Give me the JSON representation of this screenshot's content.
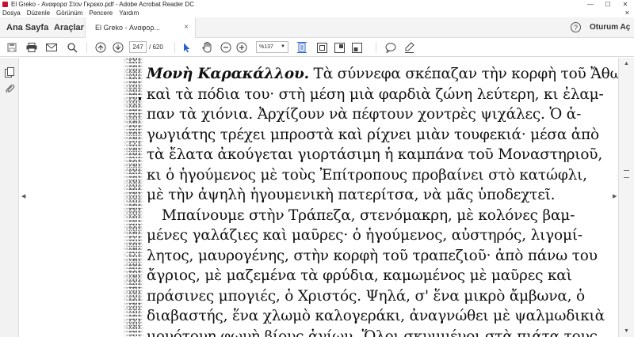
{
  "window": {
    "title": "El Greko - Αναφορα Στον Γκρεκο.pdf - Adobe Acrobat Reader DC",
    "minimize": "—",
    "maximize": "☐",
    "close": "✕"
  },
  "menu": {
    "items": [
      "Dosya",
      "Düzenle",
      "Görünüm",
      "Pencere",
      "Yardım"
    ],
    "close_doc": "×"
  },
  "tabs": {
    "home": "Ana Sayfa",
    "tools": "Araçlar",
    "document": "El Greko - Αναφορ...",
    "document_close": "×",
    "help": "?",
    "signin": "Oturum Aç"
  },
  "toolbar": {
    "page_current": "247",
    "page_count": "/ 620",
    "zoom": "%137"
  },
  "document": {
    "lines": [
      {
        "bold": "Μονὴ Καρακάλλου.",
        "text": " Τὰ σύννεφα σκέπαζαν τὴν κορφὴ τοῦ Ἄθω"
      },
      {
        "bold": "",
        "text": "καὶ τὰ πόδια του· στὴ μέση μιὰ φαρδιὰ ζώνη λεύτερη, κι ἐλαμ-"
      },
      {
        "bold": "",
        "text": "παν τὰ χιόνια. Ἀρχίζουν νὰ πέφτουν χοντρὲς ψιχάλες. Ὁ ἀ-"
      },
      {
        "bold": "",
        "text": "γωγιάτης τρέχει μπροστὰ καὶ ρίχνει μιὰν τουφεκιά· μέσα ἀπὸ"
      },
      {
        "bold": "",
        "text": "τὰ ἔλατα ἀκούγεται γιορτάσιμη ἡ καμπάνα τοῦ Μοναστηριοῦ,"
      },
      {
        "bold": "",
        "text": "κι ὁ ἡγούμενος μὲ τοὺς Ἐπίτροπους προβαίνει στὸ κατώφλι,"
      },
      {
        "bold": "",
        "text": "μὲ τὴν ἀψηλὴ ἡγουμενικὴ πατερίτσα, νὰ μᾶς ὑποδεχτεῖ."
      },
      {
        "bold": "",
        "text": "Μπαίνουμε στὴν Τράπεζα, στενόμακρη, μὲ κολόνες βαμ-",
        "indent": true
      },
      {
        "bold": "",
        "text": "μένες γαλάζιες καὶ μαῦρες· ὁ ἡγούμενος, αὐστηρός, λιγομί-"
      },
      {
        "bold": "",
        "text": "λητος, μαυρογένης, στὴν κορφὴ τοῦ τραπεζιοῦ· ἀπὸ πάνω του"
      },
      {
        "bold": "",
        "text": "ἄγριος, μὲ μαζεμένα τὰ φρύδια, καμωμένος μὲ μαῦρες καὶ"
      },
      {
        "bold": "",
        "text": "πράσινες μπογιές, ὁ Χριστός. Ψηλά, σ' ἕνα μικρὸ ἄμβωνα, ὁ"
      },
      {
        "bold": "",
        "text": "διαβαστής, ἕνα χλωμὸ καλογεράκι, ἀναγνώθει μὲ ψαλμωδικιὰ"
      },
      {
        "bold": "",
        "text": "μονότονη φωνὴ βίους ἁγίων. Ὅλοι σκυμμένοι στὰ πιάτα τους,"
      }
    ]
  }
}
